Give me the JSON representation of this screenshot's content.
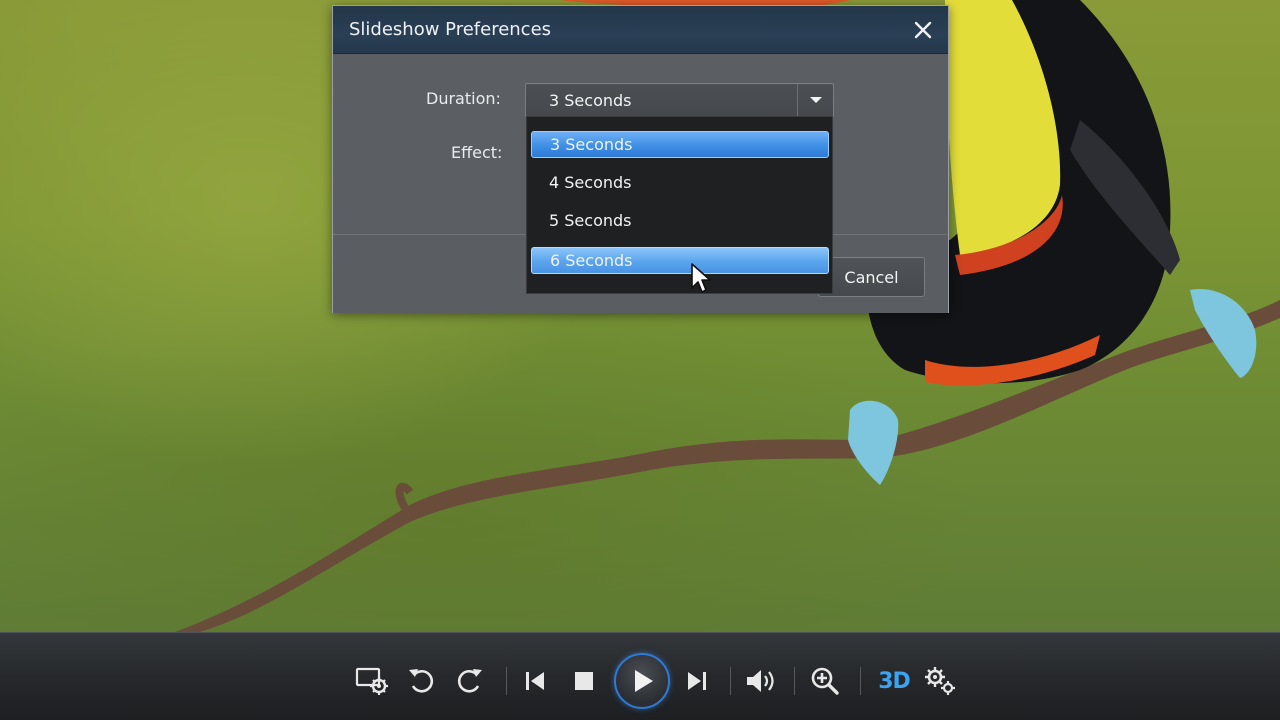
{
  "dialog": {
    "title": "Slideshow Preferences",
    "duration_label": "Duration:",
    "effect_label": "Effect:",
    "duration_value": "3 Seconds",
    "cancel_label": "Cancel"
  },
  "dropdown": {
    "options": [
      {
        "label": "3 Seconds",
        "state": "selected"
      },
      {
        "label": "4 Seconds",
        "state": "normal"
      },
      {
        "label": "5 Seconds",
        "state": "normal"
      },
      {
        "label": "6 Seconds",
        "state": "hovered"
      }
    ]
  },
  "toolbar": {
    "buttons": [
      "slideshow-settings-icon",
      "rotate-left-icon",
      "rotate-right-icon",
      "previous-icon",
      "stop-icon",
      "play-icon",
      "next-icon",
      "volume-icon",
      "zoom-in-icon",
      "3d-icon",
      "settings-icon"
    ],
    "threed_label": "3D"
  },
  "colors": {
    "accent": "#3f8fe6",
    "dialog_bg": "#5a5d61",
    "titlebar_bg": "#25384c",
    "toolbar_bg": "#26282b"
  }
}
